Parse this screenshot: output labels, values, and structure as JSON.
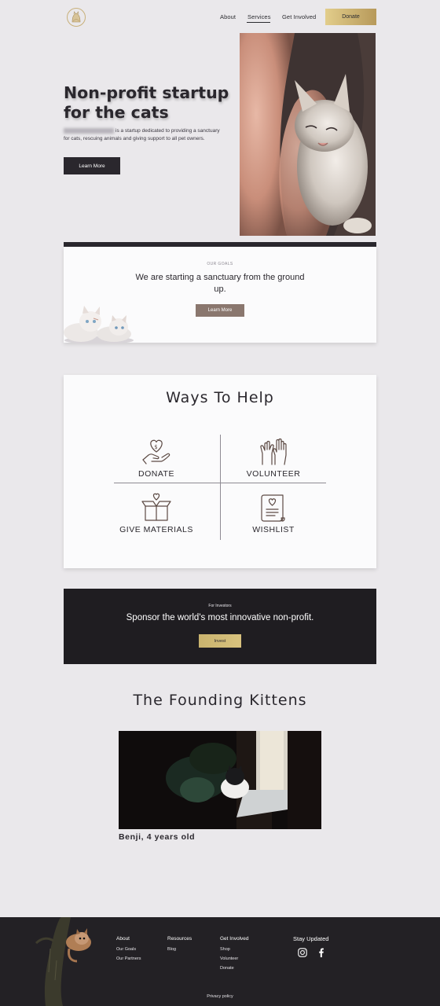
{
  "header": {
    "nav": [
      {
        "label": "About"
      },
      {
        "label": "Services"
      },
      {
        "label": "Get Involved"
      }
    ],
    "donate_label": "Donate"
  },
  "hero": {
    "title": "Non-profit startup for the cats",
    "description": "is a startup dedicated to providing a sanctuary for cats, rescuing animals and giving support to all pet owners.",
    "button_label": "Learn More"
  },
  "goals": {
    "eyebrow": "OUR GOALS",
    "text": "We are starting a sanctuary from the ground up.",
    "button_label": "Learn More"
  },
  "ways_to_help": {
    "title": "Ways To Help",
    "items": [
      {
        "label": "DONATE",
        "icon": "hand-heart-coin-icon"
      },
      {
        "label": "VOLUNTEER",
        "icon": "raised-hands-icon"
      },
      {
        "label": "GIVE MATERIALS",
        "icon": "box-heart-icon"
      },
      {
        "label": "WISHLIST",
        "icon": "scroll-heart-icon"
      }
    ]
  },
  "investors": {
    "eyebrow": "For Investors",
    "text": "Sponsor the world's most innovative non-profit.",
    "button_label": "Invest"
  },
  "founding": {
    "title": "The Founding Kittens",
    "caption": "Benji, 4 years old"
  },
  "footer": {
    "col1": {
      "heading": "About",
      "links": [
        "Our Goals",
        "Our Partners"
      ]
    },
    "col2": {
      "heading": "Resources",
      "links": [
        "Blog"
      ]
    },
    "col3": {
      "heading": "Get Involved",
      "links": [
        "Shop",
        "Volunteer",
        "Donate"
      ]
    },
    "col4": {
      "heading": "Stay Updated"
    },
    "social": [
      "instagram-icon",
      "facebook-icon"
    ],
    "privacy": "Privacy policy"
  },
  "colors": {
    "background": "#eae8eb",
    "dark": "#2a272d",
    "gold": "#c9b36e",
    "goals_button": "#8a776e"
  }
}
